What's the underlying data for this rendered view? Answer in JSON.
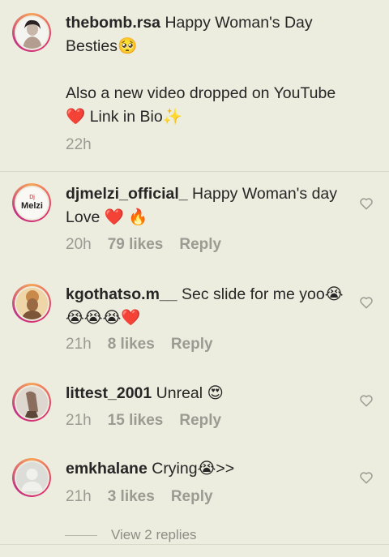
{
  "caption": {
    "username": "thebomb.rsa",
    "text_line1": " Happy Woman's Day Besties🥺",
    "text_line2": "Also a new video dropped on YouTube ❤️ Link in Bio✨",
    "time": "22h",
    "avatar_icon": "profile-photo-woman"
  },
  "comments": [
    {
      "username": "djmelzi_official_",
      "text": " Happy Woman's day Love ❤️ 🔥",
      "time": "20h",
      "likes": "79 likes",
      "reply": "Reply",
      "avatar_label": "Melzi"
    },
    {
      "username": "kgothatso.m__",
      "text": " Sec slide for me yoo😭😭😭😭❤️",
      "time": "21h",
      "likes": "8 likes",
      "reply": "Reply"
    },
    {
      "username": "littest_2001",
      "text": " Unreal 😍",
      "time": "21h",
      "likes": "15 likes",
      "reply": "Reply"
    },
    {
      "username": "emkhalane",
      "text": " Crying😭>>",
      "time": "21h",
      "likes": "3 likes",
      "reply": "Reply"
    }
  ],
  "view_replies": "View 2 replies",
  "colors": {
    "background": "#ecedde",
    "text": "#262626",
    "meta": "#9b9b93",
    "ring_start": "#f6a45b",
    "ring_end": "#c13584"
  }
}
